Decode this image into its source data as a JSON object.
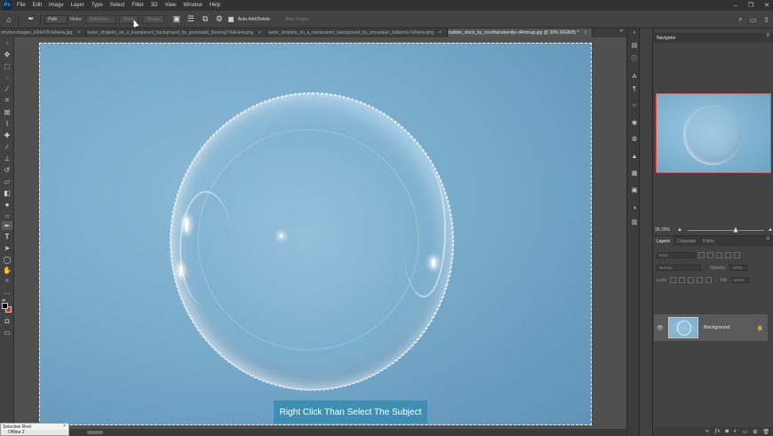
{
  "app": {
    "logo": "Ps",
    "menu": [
      "File",
      "Edit",
      "Image",
      "Layer",
      "Type",
      "Select",
      "Filter",
      "3D",
      "View",
      "Window",
      "Help"
    ]
  },
  "options": {
    "mode_value": "Path",
    "make_label": "Make:",
    "selection_btn": "Selection...",
    "mask_btn": "Mask",
    "shape_btn": "Shape",
    "auto_add_label": "Auto Add/Delete",
    "align_edges_label": "Align Edges"
  },
  "tabs": [
    {
      "label": "shuttercimages_d3tk478-fullview.jpg",
      "active": false
    },
    {
      "label": "water_droplets_on_a_transparent_background_by_prussiaart_dassnxj7-fullview.png",
      "active": false
    },
    {
      "label": "water_droplets_on_a_transparent_background_by_prussiaart_dafaem1-fullview.png",
      "active": false
    },
    {
      "label": "bubble_stock_by_lovetheirsbenitje-d4mmap.jpg @ 39% (RGB/8) *",
      "active": true
    }
  ],
  "caption": "Right Click Than Select The Subject",
  "navigator": {
    "title": "Navigator",
    "zoom": "39.39%",
    "zoom_fraction": 0.6
  },
  "layers_panel": {
    "tabs": [
      "Layers",
      "Channels",
      "Paths"
    ],
    "kind_placeholder": "Kind",
    "blend_mode": "Normal",
    "opacity_label": "Opacity:",
    "opacity_value": "100%",
    "lock_label": "Lock:",
    "fill_label": "Fill:",
    "fill_value": "100%",
    "layer_name": "Background"
  },
  "mini_panel": {
    "title": "Selective Reel",
    "row": "Offline 2"
  },
  "colors": {
    "accent_caption": "#3f8fb4",
    "navigator_frame": "#ff4a3a",
    "foreground": "#000000",
    "background": "#e0261f"
  },
  "icons": {
    "toolbar": [
      "move-icon",
      "marquee-icon",
      "lasso-icon",
      "quick-select-icon",
      "crop-icon",
      "frame-icon",
      "eyedropper-icon",
      "healing-icon",
      "brush-icon",
      "stamp-icon",
      "history-brush-icon",
      "eraser-icon",
      "gradient-icon",
      "blur-icon",
      "dodge-icon",
      "pen-icon",
      "type-icon",
      "path-select-icon",
      "shape-icon",
      "hand-icon",
      "zoom-icon",
      "more-icon"
    ]
  }
}
